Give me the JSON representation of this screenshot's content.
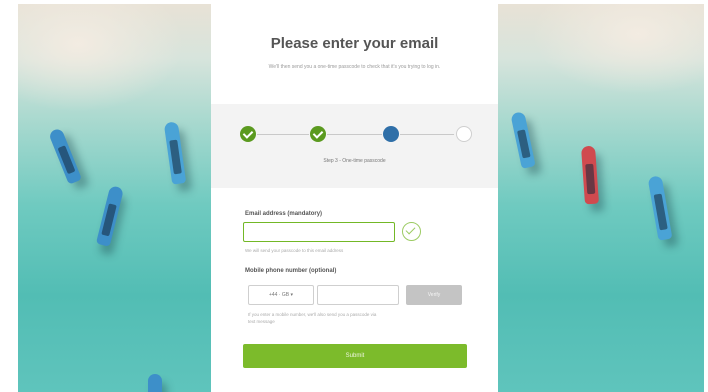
{
  "title": "Please enter your email",
  "subtitle": "We'll then send you a one-time passcode to check that it's you trying to log in.",
  "steps": {
    "states": [
      "done",
      "done",
      "active",
      "todo"
    ],
    "current_label": "Step 3 - One-time passcode"
  },
  "email": {
    "label": "Email address (mandatory)",
    "value": "",
    "placeholder": "",
    "hint": "We will send your passcode to this email address",
    "valid_icon": "checkmark-circle-icon"
  },
  "phone": {
    "label": "Mobile phone number (optional)",
    "country_code": "+44 · GB ▾",
    "value": "",
    "placeholder": "",
    "verify_label": "Verify",
    "hint": "If you enter a mobile number, we'll also send you a passcode via text message"
  },
  "submit_label": "Submit",
  "colors": {
    "accent_green": "#7cbb2b",
    "step_done": "#5b9a1f",
    "step_active": "#2f6fa8",
    "field_valid_border": "#73b826",
    "disabled_button": "#c4c4c4"
  }
}
